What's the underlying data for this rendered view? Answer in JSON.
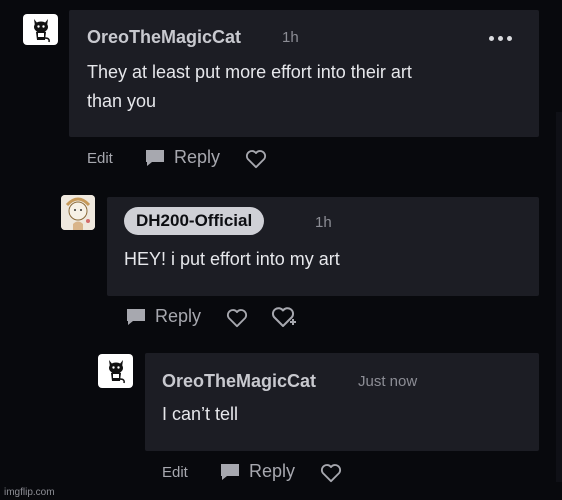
{
  "comments": [
    {
      "author": "OreoTheMagicCat",
      "time": "1h",
      "body_lines": [
        "They at least put more effort into their art",
        "than you"
      ],
      "actions": {
        "edit": "Edit",
        "reply": "Reply"
      },
      "icons": [
        "cat-avatar",
        "more-icon",
        "reply-bubble-icon",
        "heart-icon"
      ]
    },
    {
      "author": "DH200-Official",
      "time": "1h",
      "body_lines": [
        "HEY! i put effort into my art"
      ],
      "actions": {
        "reply": "Reply"
      },
      "icons": [
        "doodle-avatar",
        "reply-bubble-icon",
        "heart-icon",
        "award-heart-icon"
      ]
    },
    {
      "author": "OreoTheMagicCat",
      "time": "Just now",
      "body_lines": [
        "I can’t tell"
      ],
      "actions": {
        "edit": "Edit",
        "reply": "Reply"
      },
      "icons": [
        "cat-avatar",
        "reply-bubble-icon",
        "heart-icon"
      ]
    }
  ],
  "watermark": "imgflip.com",
  "colors": {
    "background": "#08090d",
    "bubble": "#1c1d24",
    "author_pill": "#cfd0d6",
    "action_text": "#a7a8af"
  }
}
